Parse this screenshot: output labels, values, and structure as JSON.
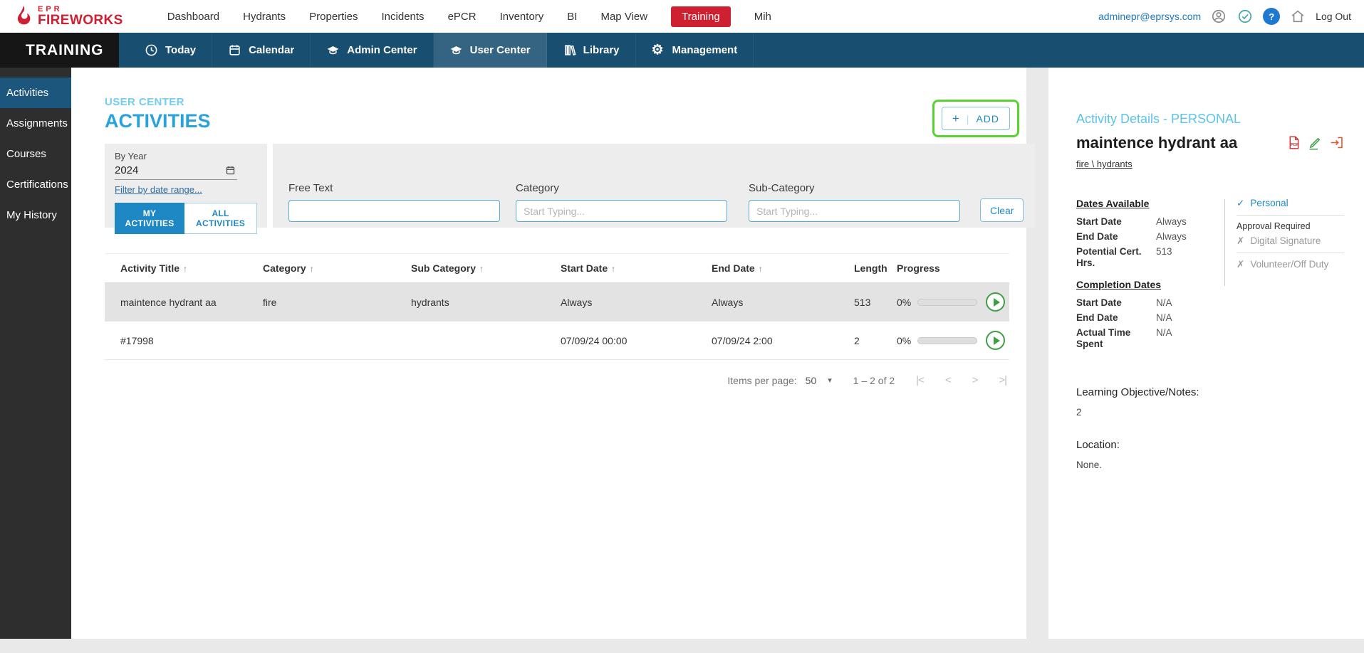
{
  "colors": {
    "brand_red": "#ce2030",
    "bar_blue": "#184e70",
    "accent_blue": "#1e88c5",
    "light_blue": "#5bc4ea",
    "highlight_green": "#58d431",
    "alert_red": "#f23b2f",
    "play_green": "#3f9e43"
  },
  "topbar": {
    "logo_top": "EPR",
    "logo_main": "FIREWORKS",
    "nav": [
      "Dashboard",
      "Hydrants",
      "Properties",
      "Incidents",
      "ePCR",
      "Inventory",
      "BI",
      "Map View",
      "Training",
      "Mih"
    ],
    "email": "adminepr@eprsys.com",
    "logout_label": "Log Out"
  },
  "appbar": {
    "title": "TRAINING",
    "items": [
      {
        "label": "Today",
        "icon": "clock-icon"
      },
      {
        "label": "Calendar",
        "icon": "calendar-icon"
      },
      {
        "label": "Admin Center",
        "icon": "graduation-cap-icon"
      },
      {
        "label": "User Center",
        "icon": "graduation-cap-icon"
      },
      {
        "label": "Library",
        "icon": "books-icon"
      },
      {
        "label": "Management",
        "icon": "gear-icon"
      }
    ]
  },
  "sidebar": {
    "items": [
      "Activities",
      "Assignments",
      "Courses",
      "Certifications",
      "My History"
    ]
  },
  "main": {
    "section_label": "USER CENTER",
    "title": "ACTIVITIES",
    "add_label": "ADD",
    "filters": {
      "by_year_label": "By Year",
      "year_value": "2024",
      "date_range_link": "Filter by date range...",
      "my_activities": "MY ACTIVITIES",
      "all_activities": "ALL ACTIVITIES",
      "free_text_label": "Free Text",
      "category_label": "Category",
      "subcategory_label": "Sub-Category",
      "typing_placeholder": "Start Typing...",
      "clear_label": "Clear"
    },
    "table": {
      "col_title": "Activity Title",
      "col_category": "Category",
      "col_subcategory": "Sub Category",
      "col_start": "Start Date",
      "col_end": "End Date",
      "col_length": "Length",
      "col_progress": "Progress",
      "rows": [
        {
          "title": "maintence hydrant aa",
          "category": "fire",
          "subcategory": "hydrants",
          "start": "Always",
          "end": "Always",
          "length": "513",
          "progress": "0%"
        },
        {
          "title": "#17998",
          "category": "",
          "subcategory": "",
          "start": "07/09/24 00:00",
          "end": "07/09/24 2:00",
          "length": "2",
          "progress": "0%"
        }
      ]
    },
    "pagination": {
      "items_per_page_label": "Items per page:",
      "items_per_page_value": "50",
      "range_label": "1 – 2 of 2"
    }
  },
  "details": {
    "header": "Activity Details - PERSONAL",
    "title": "maintence hydrant aa",
    "category_path": "fire \\ hydrants",
    "dates_available_heading": "Dates Available",
    "start_date_label": "Start Date",
    "start_date_value": "Always",
    "end_date_label": "End Date",
    "end_date_value": "Always",
    "potential_cert_label": "Potential Cert. Hrs.",
    "potential_cert_value": "513",
    "completion_heading": "Completion Dates",
    "completion_start_label": "Start Date",
    "completion_start_value": "N/A",
    "completion_end_label": "End Date",
    "completion_end_value": "N/A",
    "actual_time_label": "Actual Time Spent",
    "actual_time_value": "N/A",
    "flag_personal": "Personal",
    "approval_required_label": "Approval Required",
    "flag_digital_signature": "Digital Signature",
    "flag_volunteer": "Volunteer/Off Duty",
    "notes_label": "Learning Objective/Notes:",
    "notes_value": "2",
    "location_label": "Location:",
    "location_value": "None."
  }
}
